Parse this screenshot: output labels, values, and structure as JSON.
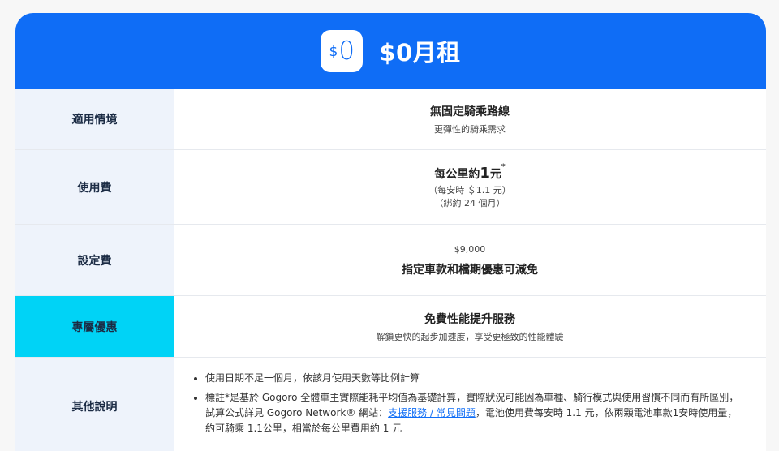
{
  "header": {
    "logo_dollar": "$",
    "logo_zero": "0",
    "title": "$0月租"
  },
  "rows": {
    "usage": {
      "label": "適用情境",
      "main": "無固定騎乘路線",
      "sub": "更彈性的騎乘需求"
    },
    "fee": {
      "label": "使用費",
      "prefix": "每公里約",
      "amount": "1",
      "unit": "元",
      "mark": "*",
      "line1": "（每安時 ＄1.1 元）",
      "line2": "（綁約 24 個月）"
    },
    "setup": {
      "label": "設定費",
      "price": "$9,000",
      "main": "指定車款和檔期優惠可減免"
    },
    "perk": {
      "label": "專屬優惠",
      "main": "免費性能提升服務",
      "sub": "解鎖更快的起步加速度，享受更極致的性能體驗"
    },
    "notes": {
      "label": "其他說明",
      "item1": "使用日期不足一個月，依該月使用天數等比例計算",
      "item2_before": "標註*是基於 Gogoro 全體車主實際能耗平均值為基礎計算，實際狀況可能因為車種、騎行模式與使用習慣不同而有所區別， 試算公式詳見 Gogoro Network® 網站：",
      "item2_link": "支援服務 / 常見問題",
      "item2_after": "，電池使用費每安時 1.1 元，依兩顆電池車款1安時使用量，約可騎乘 1.1公里，相當於每公里費用約 1 元"
    }
  },
  "colors": {
    "brand_blue": "#0f6df6",
    "highlight_cyan": "#00d3f6",
    "label_bg": "#eef3fb"
  }
}
